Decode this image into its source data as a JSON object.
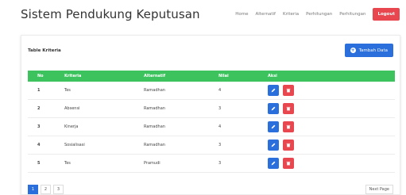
{
  "app": {
    "title": "Sistem Pendukung Keputusan"
  },
  "nav": {
    "items": [
      "Home",
      "Alternatif",
      "Kriteria",
      "Perhitungan",
      "Perhitungan"
    ],
    "logout_label": "Logout"
  },
  "card": {
    "title": "Table Kriteria",
    "add_label": "Tambah Data"
  },
  "table": {
    "headers": [
      "No",
      "Kriteria",
      "Alternatif",
      "Nilai",
      "Aksi"
    ],
    "rows": [
      {
        "no": "1",
        "kriteria": "Tes",
        "alternatif": "Ramadhan",
        "nilai": "4"
      },
      {
        "no": "2",
        "kriteria": "Absensi",
        "alternatif": "Ramadhan",
        "nilai": "3"
      },
      {
        "no": "3",
        "kriteria": "Kinerja",
        "alternatif": "Ramadhan",
        "nilai": "4"
      },
      {
        "no": "4",
        "kriteria": "Sosialisasi",
        "alternatif": "Ramadhan",
        "nilai": "3"
      },
      {
        "no": "5",
        "kriteria": "Tes",
        "alternatif": "Pramudi",
        "nilai": "3"
      }
    ]
  },
  "pagination": {
    "pages": [
      "1",
      "2",
      "3"
    ],
    "next_label": "Next Page"
  },
  "colors": {
    "primary": "#2a6fdb",
    "danger": "#e8474f",
    "header_green": "#3cc35e"
  },
  "icons": {
    "edit": "pencil-icon",
    "delete": "trash-icon",
    "add": "plus-circle-icon"
  }
}
